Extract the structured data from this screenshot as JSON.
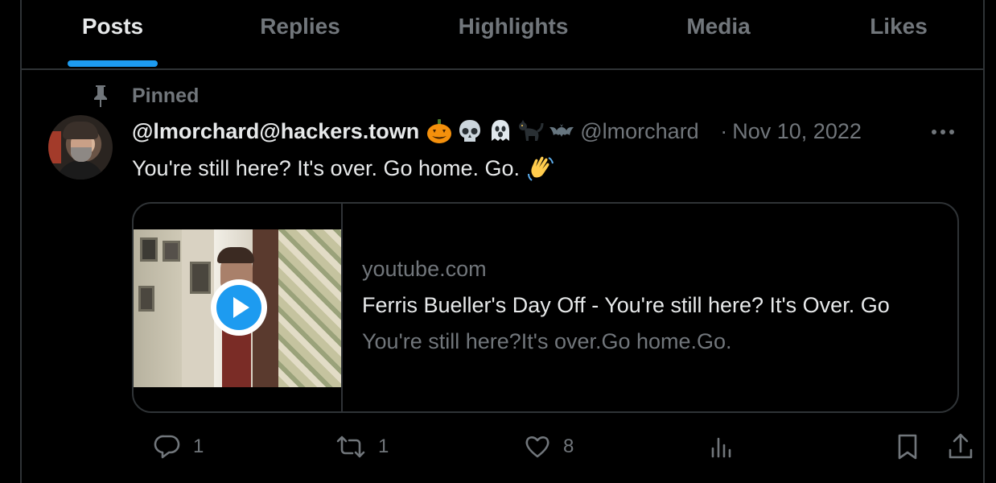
{
  "tabs": [
    {
      "label": "Posts",
      "active": true
    },
    {
      "label": "Replies",
      "active": false
    },
    {
      "label": "Highlights",
      "active": false
    },
    {
      "label": "Media",
      "active": false
    },
    {
      "label": "Likes",
      "active": false
    }
  ],
  "post": {
    "pinned_label": "Pinned",
    "display_name": "@lmorchard@hackers.town",
    "name_emojis": [
      "jack-o-lantern",
      "skull",
      "ghost",
      "black-cat",
      "bat"
    ],
    "handle": "@lmorchard",
    "separator": "·",
    "date": "Nov 10, 2022",
    "text": "You're still here? It's over. Go home. Go.",
    "text_emoji": "waving-hand",
    "card": {
      "domain": "youtube.com",
      "title": "Ferris Bueller's Day Off - You're still here? It's Over. Go",
      "description": "You're still here?It's over.Go home.Go."
    },
    "actions": {
      "replies": "1",
      "reposts": "1",
      "likes": "8"
    }
  },
  "colors": {
    "background": "#000000",
    "text": "#e7e9ea",
    "muted": "#71767b",
    "accent": "#1d9bf0",
    "border": "#2f3336"
  }
}
